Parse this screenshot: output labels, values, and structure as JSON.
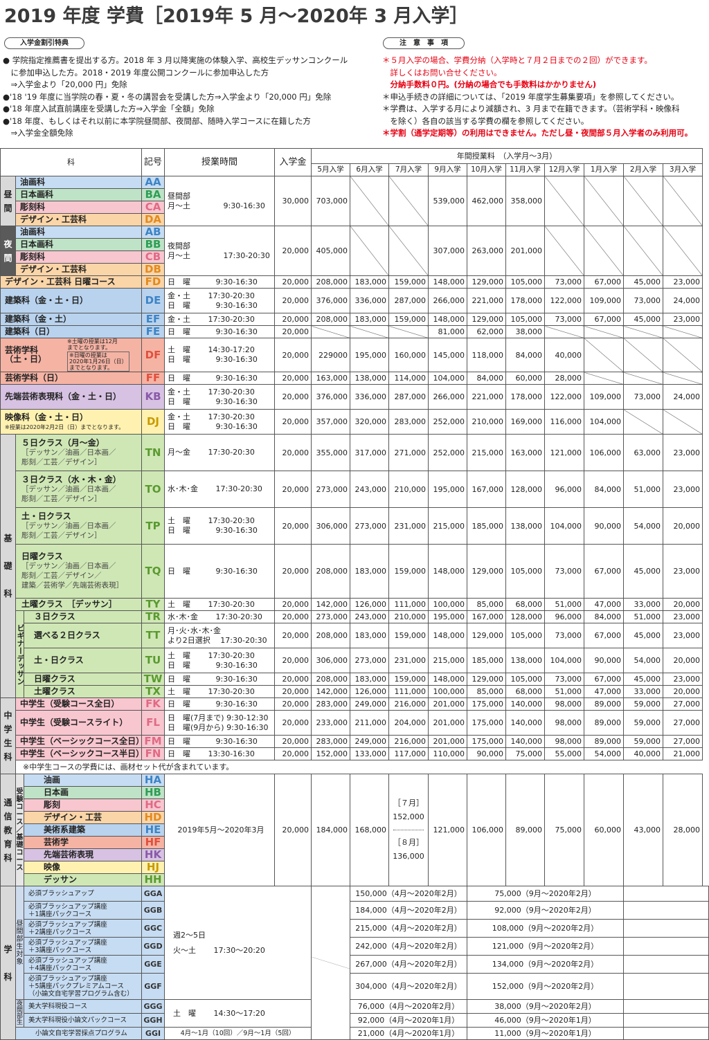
{
  "title": "2019 年度 学費［2019年 5 月〜2020年 3 月入学］",
  "benefits": {
    "label": "入学金割引特典",
    "lines": [
      "● 学院指定推薦書を提出する方。2018 年 3 月以降実施の体験入学、高校生デッサンコンクール",
      "　に参加申込した方。2018・2019 年度公開コンクールに参加申込した方",
      "　⇒入学金より「20,000 円」免除",
      "●'18 '19 年度に当学院の春・夏・冬の講習会を受講した方⇒入学金より「20,000 円」免除",
      "●'18 年度入試直前講座を受講した方⇒入学金「全額」免除",
      "●'18 年度、もしくはそれ以前に本学院昼間部、夜間部、随時入学コースに在籍した方",
      "　⇒入学金全額免除"
    ]
  },
  "notes": {
    "label": "注　意　事　項",
    "l1": "＊５月入学の場合、学費分納（入学時と７月２日までの２回）ができます。",
    "l2": "　詳しくはお問い合せください。",
    "l3": "　分納手数料０円。(分納の場合でも手数料はかかりません)",
    "l4": "＊申込手続きの詳細については、「2019 年度学生募集要項」を参照してください。",
    "l5": "＊学費は、入学する月により減額され、3 月まで在籍できます。（芸術学科・映像科",
    "l6": "　を除く）各自の該当する学費の欄を参照してください。",
    "l7": "＊学割（通学定期等）の利用はできません。ただし昼・夜間部５月入学者のみ利用可。"
  },
  "table": {
    "h_ka": "科",
    "h_kigo": "記号",
    "h_jikan": "授業時間",
    "h_nyugaku": "入学金",
    "h_nenkan": "年間授業料　（入学月〜3月）",
    "months": [
      "5月入学",
      "6月入学",
      "7月入学",
      "9月入学",
      "10月入学",
      "11月入学",
      "12月入学",
      "1月入学",
      "2月入学",
      "3月入学"
    ],
    "hiruma": {
      "sec": "昼\n間",
      "rows": [
        {
          "name": "油画科",
          "code": "AA"
        },
        {
          "name": "日本画科",
          "code": "BA"
        },
        {
          "name": "彫刻科",
          "code": "CA"
        },
        {
          "name": "デザイン・工芸科",
          "code": "DA"
        }
      ],
      "time": "昼間部\n月〜土　　　　 9:30-16:30",
      "fee": "30,000",
      "vals": [
        "703,000",
        "539,000",
        "462,000",
        "358,000"
      ]
    },
    "yakan": {
      "sec": "夜\n間",
      "rows": [
        {
          "name": "油画科",
          "code": "AB"
        },
        {
          "name": "日本画科",
          "code": "BB"
        },
        {
          "name": "彫刻科",
          "code": "CB"
        },
        {
          "name": "デザイン・工芸科",
          "code": "DB"
        }
      ],
      "time": "夜間部\n月〜土　　　　 17:30-20:30",
      "fee": "20,000",
      "vals": [
        "405,000",
        "307,000",
        "263,000",
        "201,000"
      ]
    },
    "rows_mid": [
      {
        "name": "デザイン・工芸科 日曜コース",
        "code": "FD",
        "time": "日　曜　　　 9:30-16:30",
        "fee": "20,000",
        "vals": [
          "208,000",
          "183,000",
          "159,000",
          "148,000",
          "129,000",
          "105,000",
          "73,000",
          "67,000",
          "45,000",
          "23,000"
        ]
      },
      {
        "name": "建築科（金・土・日）",
        "code": "DE",
        "time": "金・土　　 17:30-20:30\n日　曜　　　 9:30-16:30",
        "fee": "20,000",
        "vals": [
          "376,000",
          "336,000",
          "287,000",
          "266,000",
          "221,000",
          "178,000",
          "122,000",
          "109,000",
          "73,000",
          "24,000"
        ]
      },
      {
        "name": "建築科（金・土）",
        "code": "EF",
        "time": "金・土　　 17:30-20:30",
        "fee": "20,000",
        "vals": [
          "208,000",
          "183,000",
          "159,000",
          "148,000",
          "129,000",
          "105,000",
          "73,000",
          "67,000",
          "45,000",
          "23,000"
        ]
      },
      {
        "name": "建築科（日）",
        "code": "FE",
        "time": "日　曜　　　 9:30-16:30",
        "fee": "20,000",
        "vals": [
          "",
          "",
          "",
          "81,000",
          "62,000",
          "38,000",
          "",
          "",
          "",
          ""
        ]
      }
    ],
    "geijutsu": {
      "name": "芸術学科\n（土・日）",
      "note1": "※土曜の授業は12月\nまでとなります。",
      "note2": "※日曜の授業は\n2020年1月26日（日）\nまでとなります。",
      "code": "DF",
      "time": "土　曜　　 14:30-17:20\n日　曜　　　 9:30-16:30",
      "fee": "20,000",
      "vals": [
        "229000",
        "195,000",
        "160,000",
        "145,000",
        "118,000",
        "84,000",
        "40,000"
      ]
    },
    "geijutsu2": {
      "name": "芸術学科（日）",
      "code": "FF",
      "time": "日　曜　　　 9:30-16:30",
      "fee": "20,000",
      "vals": [
        "163,000",
        "138,000",
        "114,000",
        "104,000",
        "84,000",
        "60,000",
        "28,000"
      ]
    },
    "sentan": {
      "name": "先端芸術表現科（金・土・日）",
      "code": "KB",
      "time": "金・土　　 17:30-20:30\n日　曜　　　 9:30-16:30",
      "fee": "20,000",
      "vals": [
        "376,000",
        "336,000",
        "287,000",
        "266,000",
        "221,000",
        "178,000",
        "122,000",
        "109,000",
        "73,000",
        "24,000"
      ]
    },
    "eizo": {
      "name": "映像科（金・土・日）",
      "note": "※授業は2020年2月2日（日）までとなります。",
      "code": "DJ",
      "time": "金・土　　 17:30-20:30\n日　曜　　　 9:30-16:30",
      "fee": "20,000",
      "vals": [
        "357,000",
        "320,000",
        "283,000",
        "252,000",
        "210,000",
        "169,000",
        "116,000",
        "104,000"
      ]
    },
    "kiso": {
      "sec": "基\n\n礎\n\n科",
      "rows": [
        {
          "name": "５日クラス（月〜金）",
          "sub": "［デッサン／油画／日本画／\n彫刻／工芸／デザイン］",
          "code": "TN",
          "time": "月〜金　　 17:30-20:30",
          "fee": "20,000",
          "vals": [
            "355,000",
            "317,000",
            "271,000",
            "252,000",
            "215,000",
            "163,000",
            "121,000",
            "106,000",
            "63,000",
            "23,000"
          ]
        },
        {
          "name": "３日クラス（水・木・金）",
          "sub": "［デッサン／油画／日本画／\n彫刻／工芸／デザイン］",
          "code": "TO",
          "time": "水･木･金　　 17:30-20:30",
          "fee": "20,000",
          "vals": [
            "273,000",
            "243,000",
            "210,000",
            "195,000",
            "167,000",
            "128,000",
            "96,000",
            "84,000",
            "51,000",
            "23,000"
          ]
        },
        {
          "name": "土・日クラス",
          "sub": "［デッサン／油画／日本画／\n彫刻／工芸／デザイン］",
          "code": "TP",
          "time": "土　曜　　 17:30-20:30\n日　曜　　　 9:30-16:30",
          "fee": "20,000",
          "vals": [
            "306,000",
            "273,000",
            "231,000",
            "215,000",
            "185,000",
            "138,000",
            "104,000",
            "90,000",
            "54,000",
            "20,000"
          ]
        },
        {
          "name": "日曜クラス",
          "sub": "［デッサン／油画／日本画／\n彫刻／工芸／デザイン／\n建築／芸術学／先端芸術表現］",
          "code": "TQ",
          "time": "日　曜　　　 9:30-16:30",
          "fee": "20,000",
          "vals": [
            "208,000",
            "183,000",
            "159,000",
            "148,000",
            "129,000",
            "105,000",
            "73,000",
            "67,000",
            "45,000",
            "23,000"
          ]
        },
        {
          "name": "土曜クラス　［デッサン］",
          "code": "TY",
          "time": "土　曜　　 17:30-20:30",
          "fee": "20,000",
          "vals": [
            "142,000",
            "126,000",
            "111,000",
            "100,000",
            "85,000",
            "68,000",
            "51,000",
            "47,000",
            "33,000",
            "20,000"
          ]
        }
      ],
      "beginner": "ビギナーデッサン",
      "brows": [
        {
          "name": "３日クラス",
          "code": "TR",
          "time": "水･木･金　　 17:30-20:30",
          "fee": "20,000",
          "vals": [
            "273,000",
            "243,000",
            "210,000",
            "195,000",
            "167,000",
            "128,000",
            "96,000",
            "84,000",
            "51,000",
            "23,000"
          ]
        },
        {
          "name": "選べる２日クラス",
          "code": "TT",
          "time": "月･火･水･木･金\nより2日選択　 17:30-20:30",
          "fee": "20,000",
          "vals": [
            "208,000",
            "183,000",
            "159,000",
            "148,000",
            "129,000",
            "105,000",
            "73,000",
            "67,000",
            "45,000",
            "23,000"
          ]
        },
        {
          "name": "土・日クラス",
          "code": "TU",
          "time": "土　曜　　 17:30-20:30\n日　曜　　　 9:30-16:30",
          "fee": "20,000",
          "vals": [
            "306,000",
            "273,000",
            "231,000",
            "215,000",
            "185,000",
            "138,000",
            "104,000",
            "90,000",
            "54,000",
            "20,000"
          ]
        },
        {
          "name": "日曜クラス",
          "code": "TW",
          "time": "日　曜　　　 9:30-16:30",
          "fee": "20,000",
          "vals": [
            "208,000",
            "183,000",
            "159,000",
            "148,000",
            "129,000",
            "105,000",
            "73,000",
            "67,000",
            "45,000",
            "23,000"
          ]
        },
        {
          "name": "土曜クラス",
          "code": "TX",
          "time": "土　曜　　 17:30-20:30",
          "fee": "20,000",
          "vals": [
            "142,000",
            "126,000",
            "111,000",
            "100,000",
            "85,000",
            "68,000",
            "51,000",
            "47,000",
            "33,000",
            "20,000"
          ]
        }
      ]
    },
    "chugaku": {
      "sec": "中\n学\n生\n科",
      "rows": [
        {
          "name": "中学生（受験コース全日）",
          "code": "FK",
          "time": "日　曜　　　 9:30-16:30",
          "fee": "20,000",
          "vals": [
            "283,000",
            "249,000",
            "216,000",
            "201,000",
            "175,000",
            "140,000",
            "98,000",
            "89,000",
            "59,000",
            "27,000"
          ]
        },
        {
          "name": "中学生（受験コースライト）",
          "code": "FL",
          "time": "日　曜(7月まで) 9:30-12:30\n日　曜(9月から) 9:30-16:30",
          "fee": "20,000",
          "vals": [
            "233,000",
            "211,000",
            "204,000",
            "201,000",
            "175,000",
            "140,000",
            "98,000",
            "89,000",
            "59,000",
            "27,000"
          ]
        },
        {
          "name": "中学生（ベーシックコース全日）",
          "code": "FM",
          "time": "日　曜　　　 9:30-16:30",
          "fee": "20,000",
          "vals": [
            "283,000",
            "249,000",
            "216,000",
            "201,000",
            "175,000",
            "140,000",
            "98,000",
            "89,000",
            "59,000",
            "27,000"
          ]
        },
        {
          "name": "中学生（ベーシックコース半日）",
          "code": "FN",
          "time": "日　曜　　 13:30-16:30",
          "fee": "20,000",
          "vals": [
            "152,000",
            "133,000",
            "117,000",
            "110,000",
            "90,000",
            "75,000",
            "55,000",
            "54,000",
            "40,000",
            "21,000"
          ]
        }
      ],
      "footnote": "※中学生コースの学費には、画材セット代が含まれています。"
    },
    "tsushin": {
      "sec": "通\n信\n教\n育\n科",
      "sub": "受\n験\nコ\nー\nス\n／\n基\n礎\nコ\nー\nス",
      "rows": [
        {
          "name": "油画",
          "code": "HA"
        },
        {
          "name": "日本画",
          "code": "HB"
        },
        {
          "name": "彫刻",
          "code": "HC"
        },
        {
          "name": "デザイン・工芸",
          "code": "HD"
        },
        {
          "name": "美術系建築",
          "code": "HE"
        },
        {
          "name": "芸術学",
          "code": "HF"
        },
        {
          "name": "先端芸術表現",
          "code": "HK"
        },
        {
          "name": "映像",
          "code": "HJ"
        },
        {
          "name": "デッサン",
          "code": "HH"
        }
      ],
      "time": "2019年5月〜2020年3月",
      "fee": "20,000",
      "v5": "184,000",
      "v6": "168,000",
      "v7a": "［７月］",
      "v7b": "152,000",
      "v7c": "［８月］",
      "v7d": "136,000",
      "vals": [
        "121,000",
        "106,000",
        "89,000",
        "75,000",
        "60,000",
        "43,000",
        "28,000"
      ]
    },
    "gakka": {
      "sec": "学\n\n科",
      "sub1": "昼\n間\n部\n生\n対\n象",
      "sub2": "夜\n間\n部\n生",
      "rows": [
        {
          "name": "必須ブラッシュアップ",
          "code": "GGA",
          "a": "150,000（4月〜2020年2月）",
          "b": "75,000（9月〜2020年2月）"
        },
        {
          "name": "必須ブラッシュアップ講座\n＋1講座パックコース",
          "code": "GGB",
          "a": "184,000（4月〜2020年2月）",
          "b": "92,000（9月〜2020年2月）"
        },
        {
          "name": "必須ブラッシュアップ講座\n＋2講座パックコース",
          "code": "GGC",
          "a": "215,000（4月〜2020年2月）",
          "b": "108,000（9月〜2020年2月）"
        },
        {
          "name": "必須ブラッシュアップ講座\n＋3講座パックコース",
          "code": "GGD",
          "a": "242,000（4月〜2020年2月）",
          "b": "121,000（9月〜2020年2月）"
        },
        {
          "name": "必須ブラッシュアップ講座\n＋4講座パックコース",
          "code": "GGE",
          "a": "267,000（4月〜2020年2月）",
          "b": "134,000（9月〜2020年2月）"
        },
        {
          "name": "必須ブラッシュアップ講座\n＋5講座パックプレミアムコース\n（小論文自宅学習プログラム含む）",
          "code": "GGF",
          "a": "304,000（4月〜2020年2月）",
          "b": "152,000（9月〜2020年2月）"
        },
        {
          "name": "美大学科現役コース",
          "code": "GGG",
          "a": "76,000（4月〜2020年2月）",
          "b": "38,000（9月〜2020年2月）"
        },
        {
          "name": "美大学科現役小論文パックコース",
          "code": "GGH",
          "a": "92,000（4月〜2020年1月）",
          "b": "46,000（9月〜2020年1月）"
        },
        {
          "name": "小論文自宅学習採点プログラム",
          "code": "GGI",
          "a": "21,000（4月〜2020年1月）",
          "b": "11,000（9月〜2020年1月）"
        }
      ],
      "time1": "週2〜5日\n火〜土　　 17:30〜20:20",
      "time2": "土　曜　　 14:30〜17:20",
      "time3": "4月〜1月（10回）／9月〜1月（5回）"
    }
  }
}
